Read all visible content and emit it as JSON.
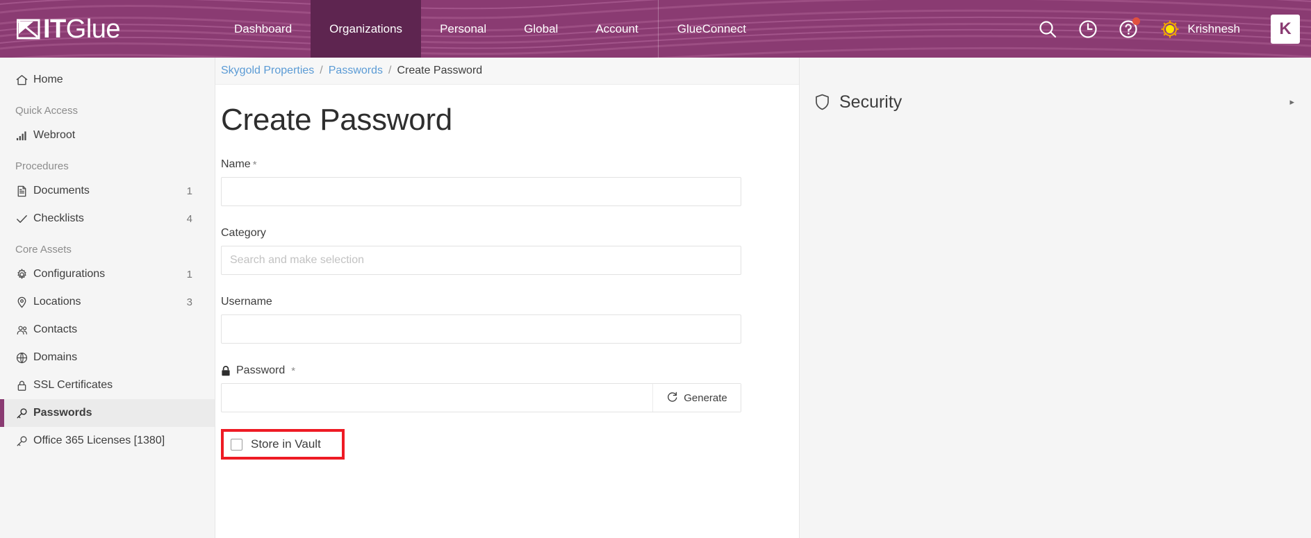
{
  "brand": {
    "name_bold": "IT",
    "name_light": "Glue",
    "mark": "itglue-logo-mark"
  },
  "topnav": {
    "links": [
      {
        "label": "Dashboard",
        "active": false,
        "divider": false
      },
      {
        "label": "Organizations",
        "active": true,
        "divider": false
      },
      {
        "label": "Personal",
        "active": false,
        "divider": false
      },
      {
        "label": "Global",
        "active": false,
        "divider": false
      },
      {
        "label": "Account",
        "active": false,
        "divider": false
      },
      {
        "label": "GlueConnect",
        "active": false,
        "divider": true
      }
    ],
    "search_icon": "search-icon",
    "history_icon": "clock-icon",
    "help_icon": "help-question-icon",
    "help_has_notification": true,
    "avatar_icon": "sun-avatar-icon",
    "username": "Krishnesh",
    "app_switcher_label": "K"
  },
  "sidebar": {
    "home": {
      "label": "Home",
      "icon": "home-icon"
    },
    "sections": [
      {
        "heading": "Quick Access",
        "items": [
          {
            "label": "Webroot",
            "icon": "bar-chart-icon",
            "count": "",
            "active": false
          }
        ]
      },
      {
        "heading": "Procedures",
        "items": [
          {
            "label": "Documents",
            "icon": "document-icon",
            "count": "1",
            "active": false
          },
          {
            "label": "Checklists",
            "icon": "check-icon",
            "count": "4",
            "active": false
          }
        ]
      },
      {
        "heading": "Core Assets",
        "items": [
          {
            "label": "Configurations",
            "icon": "gear-icon",
            "count": "1",
            "active": false
          },
          {
            "label": "Locations",
            "icon": "map-pin-icon",
            "count": "3",
            "active": false
          },
          {
            "label": "Contacts",
            "icon": "people-icon",
            "count": "",
            "active": false
          },
          {
            "label": "Domains",
            "icon": "globe-icon",
            "count": "",
            "active": false
          },
          {
            "label": "SSL Certificates",
            "icon": "lock-icon",
            "count": "",
            "active": false
          },
          {
            "label": "Passwords",
            "icon": "key-icon",
            "count": "",
            "active": true
          },
          {
            "label": "Office 365 Licenses [1380]",
            "icon": "key-icon",
            "count": "",
            "active": false
          }
        ]
      }
    ]
  },
  "breadcrumb": {
    "org": "Skygold Properties",
    "section": "Passwords",
    "current": "Create Password",
    "separator": "/"
  },
  "main": {
    "title": "Create Password",
    "fields": {
      "name": {
        "label": "Name",
        "required": true,
        "value": "",
        "placeholder": ""
      },
      "category": {
        "label": "Category",
        "required": false,
        "value": "",
        "placeholder": "Search and make selection"
      },
      "username": {
        "label": "Username",
        "required": false,
        "value": "",
        "placeholder": ""
      },
      "password": {
        "label": "Password",
        "required": true,
        "value": "",
        "placeholder": "",
        "icon": "lock-icon",
        "generate_label": "Generate",
        "generate_icon": "refresh-icon"
      }
    },
    "vault": {
      "label": "Store in Vault",
      "checked": false,
      "highlighted": true
    }
  },
  "right_panel": {
    "security": {
      "title": "Security",
      "icon": "shield-icon",
      "chevron": "▸"
    }
  },
  "colors": {
    "brand_purple": "#8a3b72",
    "active_nav_purple": "#5e2550",
    "link_blue": "#5b9bd5",
    "highlight_red": "#ee1b24",
    "notification_red": "#e0503f",
    "avatar_yellow": "#ffe600"
  }
}
